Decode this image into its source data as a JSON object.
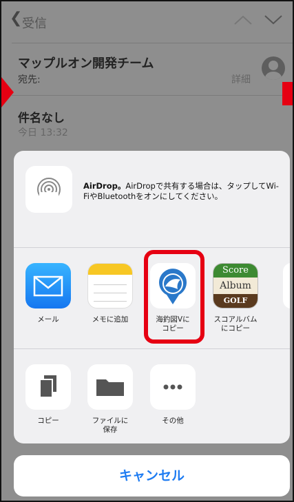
{
  "nav": {
    "back_label": "受信"
  },
  "mail": {
    "sender": "マップルオン開発チーム",
    "to_label": "宛先:",
    "detail_label": "詳細",
    "subject": "件名なし",
    "date": "今日 13:32"
  },
  "airdrop": {
    "title": "AirDrop。",
    "description": "AirDropで共有する場合は、タップしてWi-FiやBluetoothをオンにしてください。"
  },
  "apps": [
    {
      "label": "メール",
      "icon": "mail-icon"
    },
    {
      "label": "メモに追加",
      "icon": "notes-icon"
    },
    {
      "label": "海釣図Vに\nコピー",
      "icon": "umitsurizu-icon"
    },
    {
      "label": "スコアルバム\nにコピー",
      "icon": "score-album-icon"
    }
  ],
  "score_album_icon_text": {
    "line1": "Score",
    "line2": "Album",
    "line3": "GOLF"
  },
  "actions": [
    {
      "label": "コピー",
      "icon": "copy-icon"
    },
    {
      "label": "ファイルに\n保存",
      "icon": "folder-icon"
    },
    {
      "label": "その他",
      "icon": "more-icon"
    }
  ],
  "cancel_label": "キャンセル",
  "colors": {
    "accent": "#1e7cf2",
    "highlight": "#e60012",
    "mail": "#1a8ff5",
    "notes": "#f7c724",
    "score_album": "#3d8a32"
  }
}
